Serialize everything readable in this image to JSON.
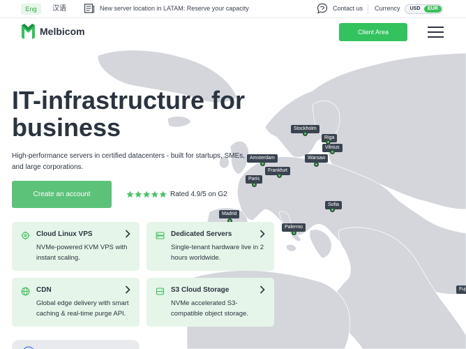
{
  "topbar": {
    "lang_active": "Eng",
    "lang_alt": "汉语",
    "announcement": "New server location in LATAM: Reserve your capacity",
    "contact": "Contact us",
    "currency_label": "Currency",
    "currency_options": [
      "USD",
      "EUR"
    ],
    "currency_selected": "EUR"
  },
  "header": {
    "brand": "Melbicom",
    "client_area": "Client Area"
  },
  "hero": {
    "title": "IT-infrastructure for business",
    "subtitle": "High-performance servers in certified datacenters - built for startups, SMEs, and large corporations.",
    "cta": "Create an account",
    "rating_text": "Rated 4.9/5 on G2",
    "rating_stars": 5
  },
  "services": [
    {
      "icon": "cloud-gear-icon",
      "title": "Cloud Linux VPS",
      "desc": "NVMe-powered KVM VPS with instant scaling."
    },
    {
      "icon": "server-icon",
      "title": "Dedicated Servers",
      "desc": "Single-tenant hardware live in 2 hours worldwide."
    },
    {
      "icon": "globe-icon",
      "title": "CDN",
      "desc": "Global edge delivery with smart caching & real-time purge API."
    },
    {
      "icon": "storage-icon",
      "title": "S3 Cloud Storage",
      "desc": "NVMe accelerated S3-compatible object storage."
    }
  ],
  "map_locations": [
    "Stockholm",
    "Riga",
    "Vilnius",
    "Amsterdam",
    "Warsaw",
    "Frankfurt",
    "Paris",
    "Sofia",
    "Madrid",
    "Palermo",
    "Fuji"
  ],
  "colors": {
    "accent": "#33c25e",
    "card_bg": "#e6f5e9",
    "map_land": "#d4d6dc",
    "label_bg": "#3a4350"
  }
}
